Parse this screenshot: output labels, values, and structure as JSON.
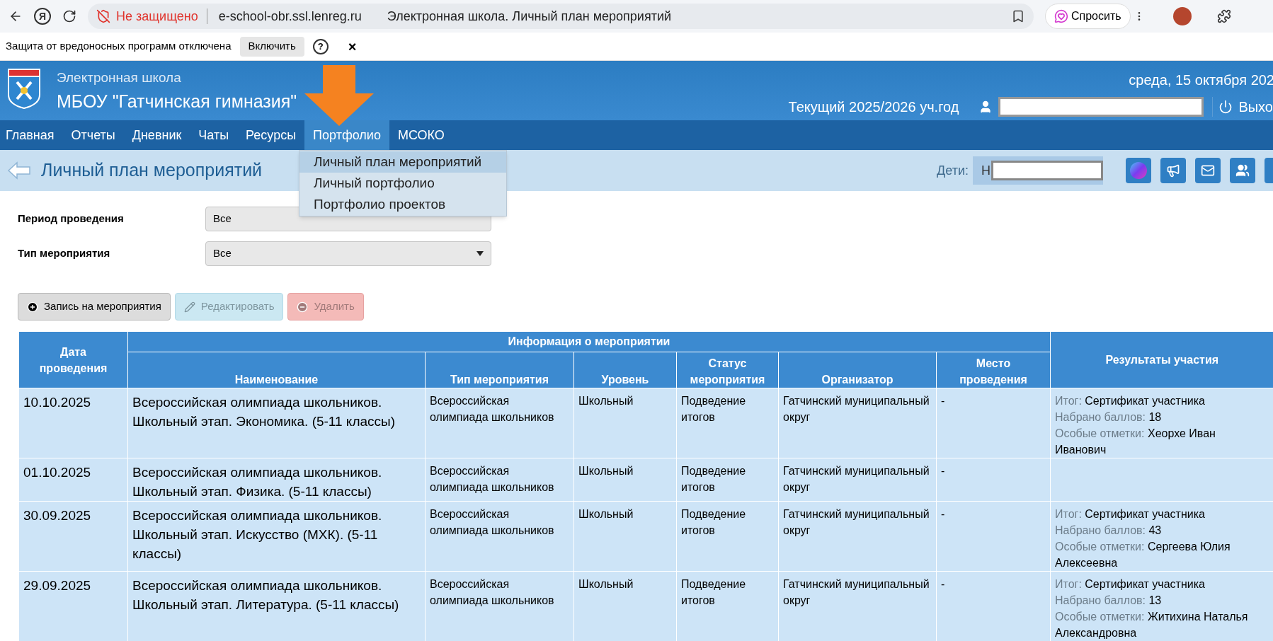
{
  "browser": {
    "logo_letter": "Я",
    "security_label": "Не защищено",
    "url": "e-school-obr.ssl.lenreg.ru",
    "page_title": "Электронная школа. Личный план мероприятий",
    "ask_button": "Спросить"
  },
  "warning_bar": {
    "message": "Защита от вредоносных программ отключена",
    "enable_button": "Включить",
    "help": "?",
    "close": "×"
  },
  "header": {
    "subtitle": "Электронная школа",
    "school": "МБОУ \"Гатчинская гимназия\"",
    "date": "среда, 15 октября 202",
    "year": "Текущий 2025/2026 уч.год",
    "logout": "Выхо"
  },
  "nav": [
    {
      "label": "Главная",
      "selected": false
    },
    {
      "label": "Отчеты",
      "selected": false
    },
    {
      "label": "Дневник",
      "selected": false
    },
    {
      "label": "Чаты",
      "selected": false
    },
    {
      "label": "Ресурсы",
      "selected": false
    },
    {
      "label": "Портфолио",
      "selected": true
    },
    {
      "label": "МСОКО",
      "selected": false
    }
  ],
  "dropdown": [
    {
      "label": "Личный план мероприятий",
      "selected": true
    },
    {
      "label": "Личный портфолио",
      "selected": false
    },
    {
      "label": "Портфолио проектов",
      "selected": false
    }
  ],
  "page": {
    "title": "Личный план мероприятий",
    "children_label": "Дети:",
    "child_visible": "Н"
  },
  "filters": [
    {
      "label": "Период проведения",
      "value": "Все",
      "arrow": false
    },
    {
      "label": "Тип мероприятия",
      "value": "Все",
      "arrow": true
    }
  ],
  "buttons": [
    {
      "label": "Запись на мероприятия",
      "kind": "add",
      "disabled": false
    },
    {
      "label": "Редактировать",
      "kind": "edit",
      "disabled": true
    },
    {
      "label": "Удалить",
      "kind": "delete",
      "disabled": true
    }
  ],
  "table": {
    "date_header": "Дата проведения",
    "group_header": "Информация о мероприятии",
    "columns": [
      "Наименование",
      "Тип мероприятия",
      "Уровень",
      "Статус мероприятия",
      "Организатор",
      "Место проведения"
    ],
    "results_header": "Результаты участия",
    "rows": [
      {
        "date": "10.10.2025",
        "name": "Всероссийская олимпиада школьников. Школьный этап. Экономика. (5-11 классы)",
        "type": "Всероссийская олимпиада школьников",
        "level": "Школьный",
        "status": "Подведение итогов",
        "organizer": "Гатчинский муниципальный округ",
        "place": "-",
        "results": [
          {
            "label": "Итог:",
            "value": "Сертификат участника"
          },
          {
            "label": "Набрано баллов:",
            "value": "18"
          },
          {
            "label": "Особые отметки:",
            "value": "Хеорхе Иван Иванович"
          }
        ]
      },
      {
        "date": "01.10.2025",
        "name": "Всероссийская олимпиада школьников. Школьный этап. Физика. (5-11 классы)",
        "type": "Всероссийская олимпиада школьников",
        "level": "Школьный",
        "status": "Подведение итогов",
        "organizer": "Гатчинский муниципальный округ",
        "place": "-"
      },
      {
        "date": "30.09.2025",
        "name": "Всероссийская олимпиада школьников. Школьный этап. Искусство (МХК). (5-11 классы)",
        "type": "Всероссийская олимпиада школьников",
        "level": "Школьный",
        "status": "Подведение итогов",
        "organizer": "Гатчинский муниципальный округ",
        "place": "-",
        "results": [
          {
            "label": "Итог:",
            "value": "Сертификат участника"
          },
          {
            "label": "Набрано баллов:",
            "value": "43"
          },
          {
            "label": "Особые отметки:",
            "value": "Сергеева Юлия Алексеевна"
          }
        ]
      },
      {
        "date": "29.09.2025",
        "name": "Всероссийская олимпиада школьников. Школьный этап. Литература. (5-11 классы)",
        "type": "Всероссийская олимпиада школьников",
        "level": "Школьный",
        "status": "Подведение итогов",
        "organizer": "Гатчинский муниципальный округ",
        "place": "-",
        "results": [
          {
            "label": "Итог:",
            "value": "Сертификат участника"
          },
          {
            "label": "Набрано баллов:",
            "value": "13"
          },
          {
            "label": "Особые отметки:",
            "value": "Житихина Наталья Александровна"
          }
        ]
      }
    ]
  }
}
